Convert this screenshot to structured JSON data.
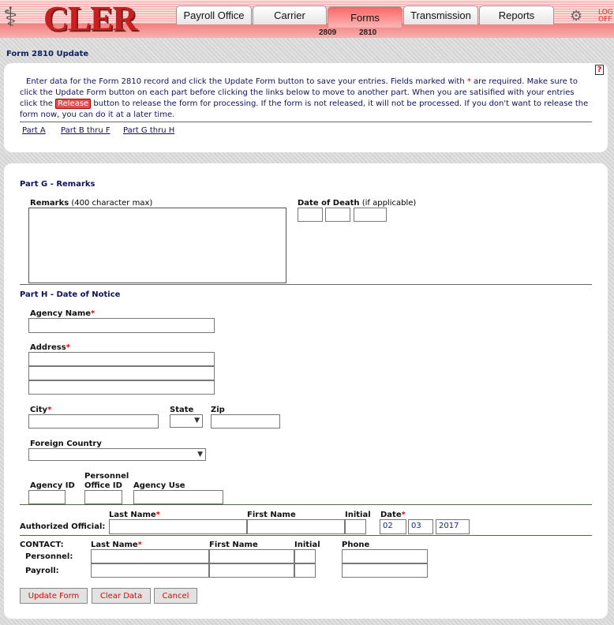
{
  "header": {
    "logo": "CLER",
    "tabs": [
      "Payroll Office",
      "Carrier",
      "Forms",
      "Transmission",
      "Reports"
    ],
    "active_tab": "Forms",
    "subtabs": [
      "2809",
      "2810"
    ],
    "logoff": "LOG OFF"
  },
  "page_title": "Form 2810 Update",
  "intro": {
    "text1": "Enter data for the Form 2810 record and click the Update Form button to save your entries.  Fields marked with ",
    "star": "*",
    "text2": " are required.  Make sure to click the Update Form button on each part before clicking the links below to move to another part.  When you are satisified with your entries click the ",
    "release": "Release",
    "text3": " button to release the form for processing.  If the form is not released, it will not be processed.  If you don't want to release the form now, you can do it at a later time.",
    "help": "?"
  },
  "links": [
    "Part A",
    "Part B thru F",
    "Part G thru H"
  ],
  "part_g": {
    "heading": "Part G - Remarks",
    "remarks_label": "Remarks",
    "remarks_hint": " (400 character max)",
    "remarks_value": "",
    "dod_label": "Date of Death",
    "dod_hint": " (if applicable)"
  },
  "part_h": {
    "heading": "Part H - Date of Notice",
    "agency_name": "Agency Name",
    "address": "Address",
    "city": "City",
    "state": "State",
    "zip": "Zip",
    "foreign_country": "Foreign Country",
    "agency_id": "Agency ID",
    "personnel_office_id_1": "Personnel",
    "personnel_office_id_2": "Office ID",
    "agency_use": "Agency Use"
  },
  "authorized": {
    "label": "Authorized Official:",
    "last": "Last Name",
    "first": "First Name",
    "initial": "Initial",
    "date": "Date",
    "month": "02",
    "day": "03",
    "year": "2017"
  },
  "contact": {
    "label": "CONTACT:",
    "last": "Last Name",
    "first": "First Name",
    "initial": "Initial",
    "phone": "Phone",
    "personnel": "Personnel:",
    "payroll": "Payroll:"
  },
  "buttons": {
    "update": "Update Form",
    "clear": "Clear Data",
    "cancel": "Cancel"
  }
}
